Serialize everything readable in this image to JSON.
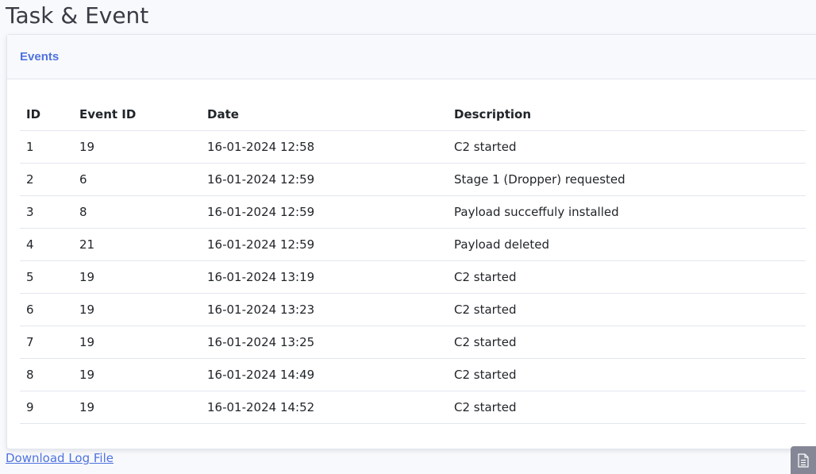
{
  "page": {
    "title": "Task & Event"
  },
  "card": {
    "header_title": "Events"
  },
  "table": {
    "columns": [
      "ID",
      "Event ID",
      "Date",
      "Description"
    ],
    "rows": [
      {
        "id": "1",
        "event_id": "19",
        "date": "16-01-2024 12:58",
        "description": "C2 started"
      },
      {
        "id": "2",
        "event_id": "6",
        "date": "16-01-2024 12:59",
        "description": "Stage 1 (Dropper) requested"
      },
      {
        "id": "3",
        "event_id": "8",
        "date": "16-01-2024 12:59",
        "description": "Payload succeffuly installed"
      },
      {
        "id": "4",
        "event_id": "21",
        "date": "16-01-2024 12:59",
        "description": "Payload deleted"
      },
      {
        "id": "5",
        "event_id": "19",
        "date": "16-01-2024 13:19",
        "description": "C2 started"
      },
      {
        "id": "6",
        "event_id": "19",
        "date": "16-01-2024 13:23",
        "description": "C2 started"
      },
      {
        "id": "7",
        "event_id": "19",
        "date": "16-01-2024 13:25",
        "description": "C2 started"
      },
      {
        "id": "8",
        "event_id": "19",
        "date": "16-01-2024 14:49",
        "description": "C2 started"
      },
      {
        "id": "9",
        "event_id": "19",
        "date": "16-01-2024 14:52",
        "description": "C2 started"
      }
    ]
  },
  "footer": {
    "download_label": "Download Log File"
  },
  "widget": {
    "icon": "file-icon"
  },
  "colors": {
    "accent": "#4e73df",
    "background": "#f8f9fc",
    "border": "#e3e6f0",
    "title": "#3a3b45"
  }
}
